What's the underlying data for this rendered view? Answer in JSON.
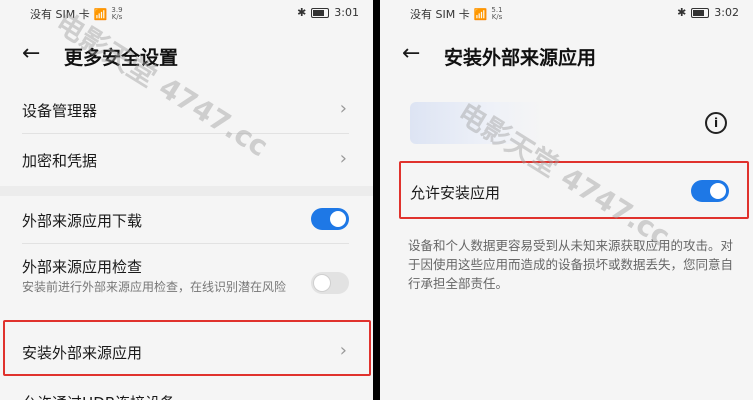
{
  "watermark": "电影天堂 4747.cc",
  "left": {
    "status": {
      "carrier": "没有 SIM 卡",
      "speed_value": "3.9",
      "speed_unit": "K/s",
      "time": "3:01"
    },
    "title": "更多安全设置",
    "items": [
      {
        "label": "设备管理器"
      },
      {
        "label": "加密和凭据"
      },
      {
        "label": "外部来源应用下载",
        "toggle": "on"
      },
      {
        "label": "外部来源应用检查",
        "sub": "安装前进行外部来源应用检查，在线识别潜在风险",
        "toggle": "off"
      },
      {
        "label": "安装外部来源应用"
      },
      {
        "label": "允许通过HDB连接设备"
      }
    ]
  },
  "right": {
    "status": {
      "carrier": "没有 SIM 卡",
      "speed_value": "5.1",
      "speed_unit": "K/s",
      "time": "3:02"
    },
    "title": "安装外部来源应用",
    "allow_label": "允许安装应用",
    "allow_toggle": "on",
    "description": "设备和个人数据更容易受到从未知来源获取应用的攻击。对于因使用这些应用而造成的设备损坏或数据丢失，您同意自行承担全部责任。"
  },
  "colors": {
    "accent": "#1e78e6",
    "highlight": "#e0322d"
  }
}
